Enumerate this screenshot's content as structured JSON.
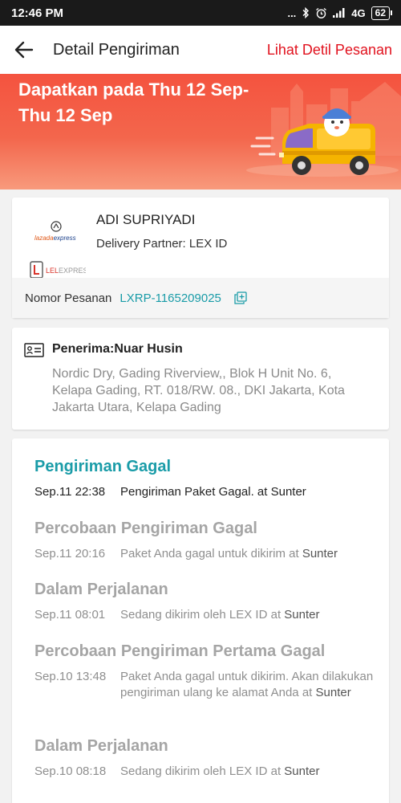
{
  "status_bar": {
    "time": "12:46 PM",
    "dots": "...",
    "network": "4G",
    "battery": "62",
    "icons": [
      "bluetooth-icon",
      "alarm-icon",
      "signal-icon"
    ]
  },
  "header": {
    "title": "Detail Pengiriman",
    "link": "Lihat Detil Pesanan",
    "back_icon": "arrow-left-icon"
  },
  "banner": {
    "text": "Dapatkan pada Thu 12 Sep-Thu 12 Sep",
    "illustration": "delivery-van-illustration"
  },
  "partner": {
    "courier_name": "ADI SUPRIYADI",
    "partner_line": "Delivery Partner: LEX ID",
    "logo_top": "lazadaexpress",
    "logo_bottom": "LELEXPRESS",
    "order_label": "Nomor Pesanan",
    "order_number": "LXRP-1165209025",
    "copy_icon": "copy-icon"
  },
  "receiver": {
    "title": "Penerima:Nuar Husin",
    "address": "Nordic Dry, Gading Riverview,, Blok H Unit No. 6, Kelapa Gading, RT. 018/RW. 08., DKI Jakarta, Kota Jakarta Utara, Kelapa Gading",
    "icon": "id-card-icon"
  },
  "tracking": [
    {
      "title": "Pengiriman Gagal",
      "time": "Sep.11 22:38",
      "desc": "Pengiriman Paket Gagal. at ",
      "location": "Sunter",
      "active": true
    },
    {
      "title": "Percobaan Pengiriman Gagal",
      "time": "Sep.11 20:16",
      "desc": "Paket Anda gagal untuk dikirim  at ",
      "location": "Sunter",
      "active": false
    },
    {
      "title": "Dalam Perjalanan",
      "time": "Sep.11 08:01",
      "desc": "Sedang dikirim oleh LEX ID at ",
      "location": "Sunter",
      "active": false
    },
    {
      "title": "Percobaan Pengiriman Pertama Gagal",
      "time": "Sep.10 13:48",
      "desc": "Paket Anda gagal untuk dikirim. Akan dilakukan pengiriman ulang ke alamat Anda at ",
      "location": "Sunter",
      "active": false
    },
    {
      "title": "Dalam Perjalanan",
      "time": "Sep.10 08:18",
      "desc": "Sedang dikirim oleh LEX ID at ",
      "location": "Sunter",
      "active": false
    }
  ],
  "colors": {
    "accent_teal": "#1a9ca8",
    "link_red": "#e1121e",
    "banner_orange": "#f4533f"
  }
}
